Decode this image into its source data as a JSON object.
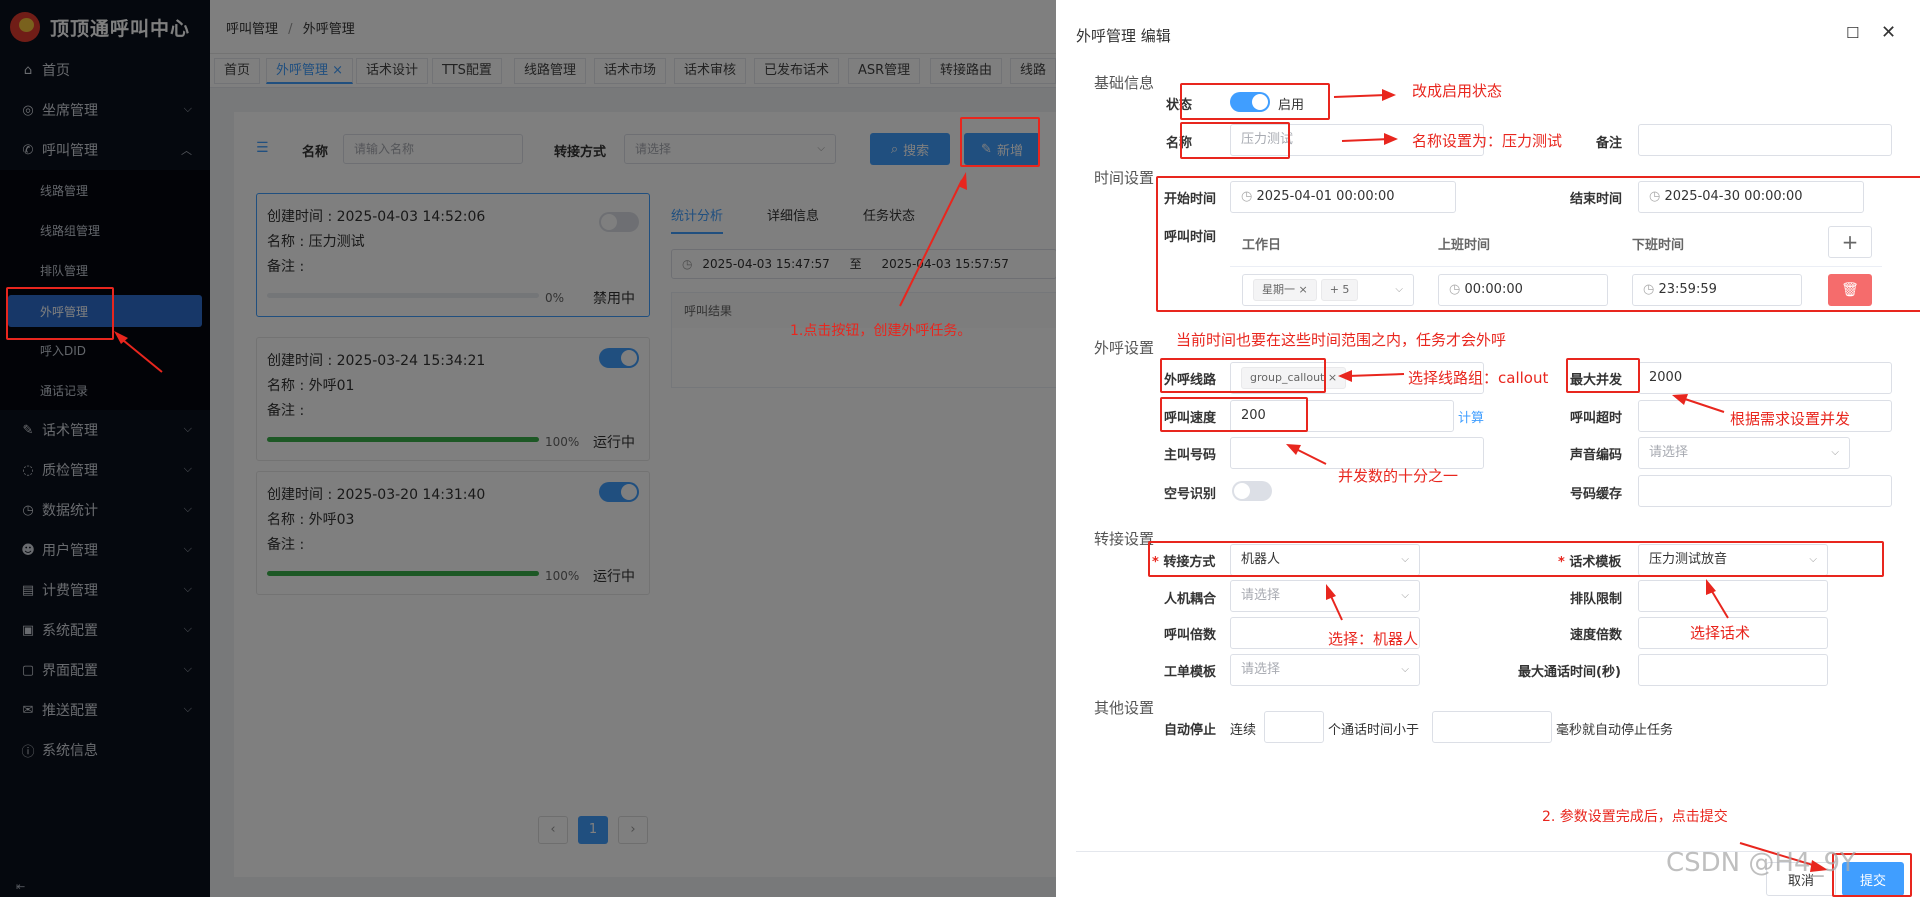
{
  "sidebar": {
    "title": "顶顶通呼叫中心",
    "items": [
      {
        "label": "首页",
        "icon": "home-icon"
      },
      {
        "label": "坐席管理",
        "icon": "headset-icon"
      },
      {
        "label": "呼叫管理",
        "icon": "phone-icon"
      },
      {
        "label": "话术管理",
        "icon": "edit-icon"
      },
      {
        "label": "质检管理",
        "icon": "chat-icon"
      },
      {
        "label": "数据统计",
        "icon": "clock-icon"
      },
      {
        "label": "用户管理",
        "icon": "users-icon"
      },
      {
        "label": "计费管理",
        "icon": "billing-icon"
      },
      {
        "label": "系统配置",
        "icon": "settings-icon"
      },
      {
        "label": "界面配置",
        "icon": "layout-icon"
      },
      {
        "label": "推送配置",
        "icon": "mail-icon"
      },
      {
        "label": "系统信息",
        "icon": "info-icon"
      }
    ],
    "sub_items": [
      "线路管理",
      "线路组管理",
      "排队管理",
      "外呼管理",
      "呼入DID",
      "通话记录"
    ]
  },
  "breadcrumb": {
    "root": "呼叫管理",
    "sep": "/",
    "current": "外呼管理"
  },
  "tabs": [
    "首页",
    "外呼管理",
    "话术设计",
    "TTS配置",
    "线路管理",
    "话术市场",
    "话术审核",
    "已发布话术",
    "ASR管理",
    "转接路由",
    "线路"
  ],
  "filter": {
    "name_label": "名称",
    "name_placeholder": "请输入名称",
    "transfer_label": "转接方式",
    "transfer_placeholder": "请选择",
    "search": "搜索",
    "add": "新增"
  },
  "tasks": [
    {
      "created": "创建时间 : 2025-04-03 14:52:06",
      "name": "名称 : 压力测试",
      "remark": "备注 :",
      "progress": 0,
      "pct": "0%",
      "state": "禁用中",
      "enabled": false
    },
    {
      "created": "创建时间 : 2025-03-24 15:34:21",
      "name": "名称 : 外呼01",
      "remark": "备注 :",
      "progress": 100,
      "pct": "100%",
      "state": "运行中",
      "enabled": true
    },
    {
      "created": "创建时间 : 2025-03-20 14:31:40",
      "name": "名称 : 外呼03",
      "remark": "备注 :",
      "progress": 100,
      "pct": "100%",
      "state": "运行中",
      "enabled": true
    }
  ],
  "stats": {
    "tabs": [
      "统计分析",
      "详细信息",
      "任务状态"
    ],
    "from": "2025-04-03 15:47:57",
    "to_label": "至",
    "to": "2025-04-03 15:57:57",
    "result_header": "呼叫结果"
  },
  "pagination": {
    "page": "1"
  },
  "drawer": {
    "title": "外呼管理 编辑",
    "sections": {
      "basic": "基础信息",
      "time": "时间设置",
      "call": "外呼设置",
      "transfer": "转接设置",
      "other": "其他设置"
    },
    "status_label": "状态",
    "status_value": "启用",
    "status_on": true,
    "name_label": "名称",
    "name_value": "压力测试",
    "remark_label": "备注",
    "start_label": "开始时间",
    "start_value": "2025-04-01 00:00:00",
    "end_label": "结束时间",
    "end_value": "2025-04-30 00:00:00",
    "calltime_label": "呼叫时间",
    "col_workday": "工作日",
    "col_on": "上班时间",
    "col_off": "下班时间",
    "workday_tag": "星期一",
    "workday_more": "+ 5",
    "on_value": "00:00:00",
    "off_value": "23:59:59",
    "line_label": "外呼线路",
    "line_tag": "group_callout",
    "max_label": "最大并发",
    "max_value": "2000",
    "speed_label": "呼叫速度",
    "speed_value": "200",
    "calc": "计算",
    "timeout_label": "呼叫超时",
    "caller_label": "主叫号码",
    "codec_label": "声音编码",
    "codec_placeholder": "请选择",
    "empty_label": "空号识别",
    "cache_label": "号码缓存",
    "transfer_label": "转接方式",
    "transfer_value": "机器人",
    "script_label": "话术模板",
    "script_value": "压力测试放音",
    "couple_label": "人机耦合",
    "couple_placeholder": "请选择",
    "queue_label": "排队限制",
    "mult_label": "呼叫倍数",
    "speedmult_label": "速度倍数",
    "ticket_label": "工单模板",
    "ticket_placeholder": "请选择",
    "maxtalk_label": "最大通话时间(秒)",
    "autostop_label": "自动停止",
    "consec": "连续",
    "lessthan": "个通话时间小于",
    "autostop_tail": "毫秒就自动停止任务",
    "cancel": "取消",
    "submit": "提交"
  },
  "annotations": {
    "a1": "1.点击按钮，创建外呼任务。",
    "a2": "改成启用状态",
    "a3": "名称设置为：压力测试",
    "a4": "当前时间也要在这些时间范围之内，任务才会外呼",
    "a5": "选择线路组：callout",
    "a6": "根据需求设置并发",
    "a7": "并发数的十分之一",
    "a8": "选择：机器人",
    "a9": "选择话术",
    "a10": "2. 参数设置完成后，点击提交",
    "watermark": "CSDN @H4_9Y"
  },
  "colors": {
    "primary": "#409eff",
    "sidebar": "#0b101c",
    "active": "#2f6fd1",
    "annotation": "#e8261e"
  }
}
